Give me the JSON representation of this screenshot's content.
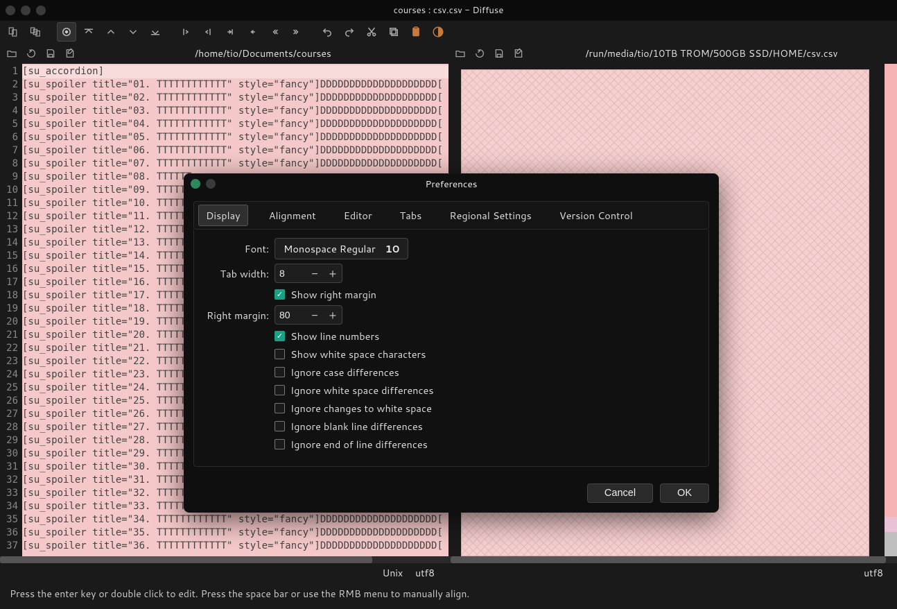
{
  "window": {
    "title": "courses : csv.csv - Diffuse"
  },
  "panes": {
    "left": {
      "path": "/home/tio/Documents/courses",
      "encoding_os": "Unix",
      "encoding": "utf8"
    },
    "right": {
      "path": "/run/media/tio/10TB TROM/500GB SSD/HOME/csv.csv",
      "encoding": "utf8"
    }
  },
  "code": {
    "first_line": "[su_accordion]",
    "line_template_prefix": "[su_spoiler title=\"",
    "line_template_mid": ". TTTTTTTTTTTT\" style=\"fancy\"]DDDDDDDDDDDDDDDDDDDD[",
    "truncated_mid": ". TTTTTT",
    "total_visible_lines": 37,
    "truncated_start": 8,
    "truncated_end": 31
  },
  "statusbar": {
    "hint": "Press the enter key or double click to edit. Press the space bar or use the RMB menu to manually align."
  },
  "preferences": {
    "title": "Preferences",
    "tabs": [
      "Display",
      "Alignment",
      "Editor",
      "Tabs",
      "Regional Settings",
      "Version Control"
    ],
    "active_tab": 0,
    "labels": {
      "font": "Font:",
      "tab_width": "Tab width:",
      "right_margin": "Right margin:"
    },
    "font_name": "Monospace Regular",
    "font_size": "10",
    "tab_width": "8",
    "right_margin": "80",
    "checks": [
      {
        "label": "Show right margin",
        "checked": true
      },
      {
        "label": "Show line numbers",
        "checked": true
      },
      {
        "label": "Show white space characters",
        "checked": false
      },
      {
        "label": "Ignore case differences",
        "checked": false
      },
      {
        "label": "Ignore white space differences",
        "checked": false
      },
      {
        "label": "Ignore changes to white space",
        "checked": false
      },
      {
        "label": "Ignore blank line differences",
        "checked": false
      },
      {
        "label": "Ignore end of line differences",
        "checked": false
      }
    ],
    "buttons": {
      "cancel": "Cancel",
      "ok": "OK"
    }
  }
}
